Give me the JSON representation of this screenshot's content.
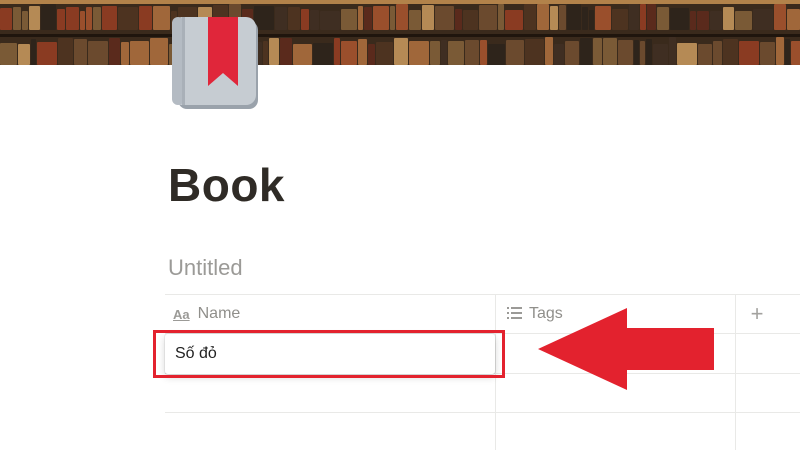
{
  "page": {
    "title": "Book",
    "icon": "bookmarked-book-icon"
  },
  "database": {
    "title": "Untitled",
    "columns": [
      {
        "label": "Name",
        "icon": "text-property-icon"
      },
      {
        "label": "Tags",
        "icon": "multi-select-list-icon"
      }
    ],
    "add_column_label": "+",
    "rows": [
      {
        "name": "Số đỏ",
        "tags": ""
      }
    ]
  },
  "annotations": {
    "highlight_color": "#e3222e",
    "arrow_color": "#e3222e"
  }
}
